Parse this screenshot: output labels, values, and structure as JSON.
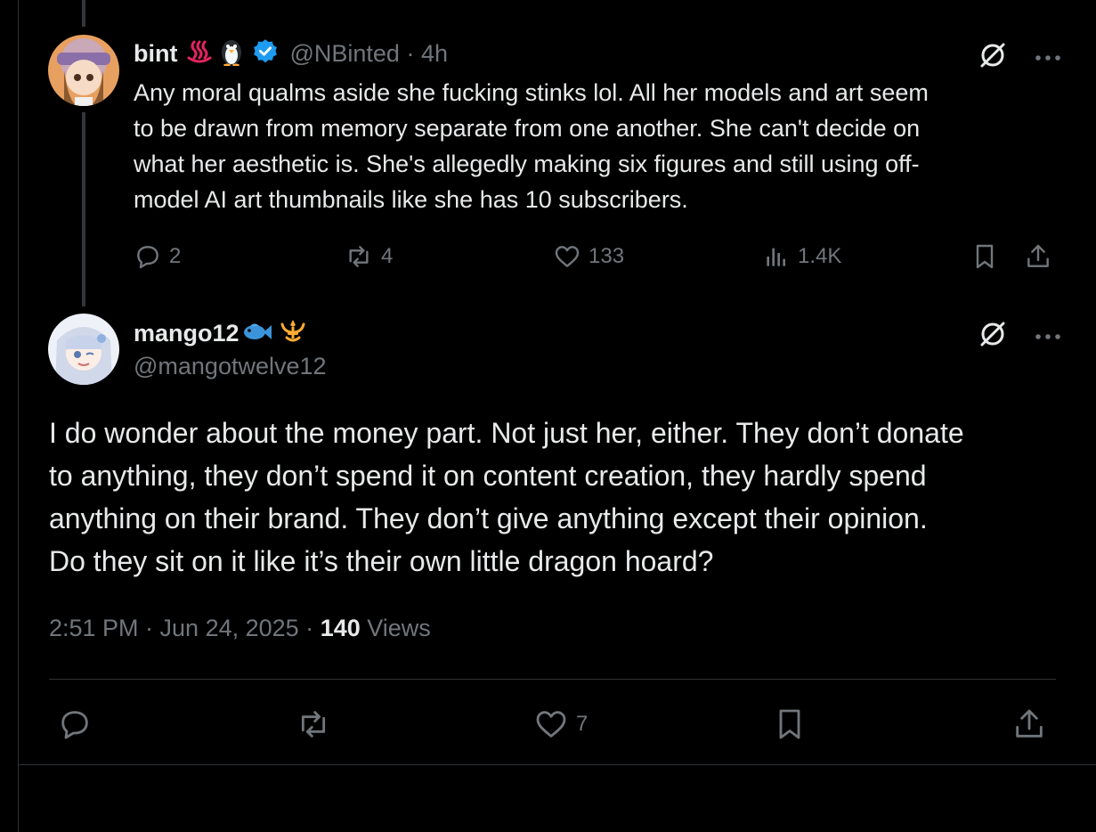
{
  "reply": {
    "display_name": "bint",
    "emojis": [
      "♨",
      "🐧"
    ],
    "handle_time": "@NBinted · 4h",
    "text": "Any moral qualms aside she fucking stinks lol. All her models and art seem to be drawn from memory separate from one another. She can't decide on what her aesthetic is. She's allegedly making six figures and still using off-model AI art thumbnails like she has 10 subscribers.",
    "lines": [
      "Any moral qualms aside she fucking stinks lol. All her models and art seem",
      "to be drawn from memory separate from one another. She can't decide on",
      "what her aesthetic is. She's allegedly making six figures and still using off-",
      "model AI art thumbnails like she has 10 subscribers."
    ],
    "stats": {
      "replies": "2",
      "reposts": "4",
      "likes": "133",
      "views": "1.4K"
    }
  },
  "main_post": {
    "display_name": "mango12",
    "emojis": [
      "🐟",
      "⚜"
    ],
    "handle": "@mangotwelve12",
    "lines": [
      "I do wonder about the money part. Not just her, either. They don’t donate",
      "to anything, they don’t spend it on content creation, they hardly spend",
      "anything on their brand. They don’t give anything except their opinion.",
      "Do they sit on it like it’s their own little dragon hoard?"
    ],
    "timestamp": "2:51 PM · Jun 24, 2025 · ",
    "views_count": "140",
    "views_label": " Views",
    "stats": {
      "likes": "7"
    }
  },
  "colors": {
    "background": "#000000",
    "text": "#e7e9ea",
    "muted": "#71767b",
    "verified": "#1d9bf0",
    "border": "#2f3336"
  }
}
